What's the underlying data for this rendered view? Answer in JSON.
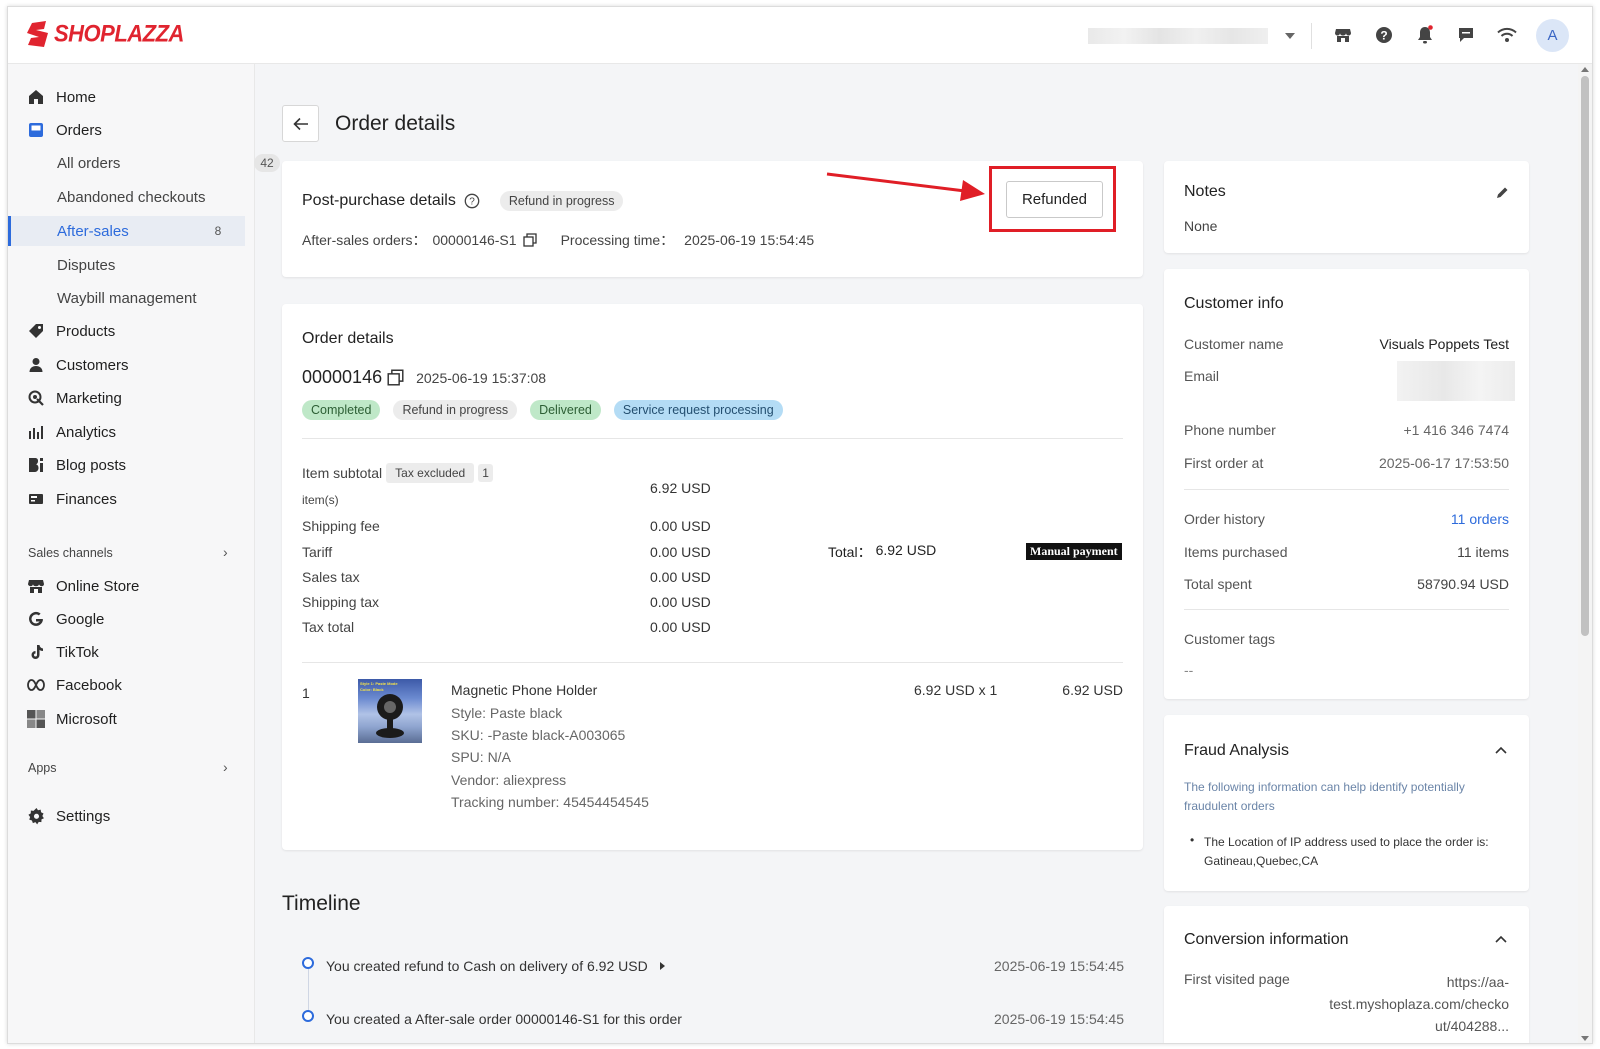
{
  "brand": {
    "logo_text": "SHOPLAZZA",
    "accent": "#e0242f"
  },
  "header": {
    "avatar_initial": "A",
    "icons": [
      "store-icon",
      "help-icon",
      "bell-icon",
      "message-icon",
      "wifi-icon"
    ]
  },
  "sidebar": {
    "items": [
      {
        "label": "Home",
        "icon": "home-icon"
      },
      {
        "label": "Orders",
        "icon": "orders-icon"
      },
      {
        "label": "Products",
        "icon": "tag-icon"
      },
      {
        "label": "Customers",
        "icon": "person-icon"
      },
      {
        "label": "Marketing",
        "icon": "marketing-icon"
      },
      {
        "label": "Analytics",
        "icon": "analytics-icon"
      },
      {
        "label": "Blog posts",
        "icon": "blog-icon"
      },
      {
        "label": "Finances",
        "icon": "finances-icon"
      }
    ],
    "orders_sub": [
      {
        "label": "All orders",
        "count": "42"
      },
      {
        "label": "Abandoned checkouts",
        "count": ""
      },
      {
        "label": "After-sales",
        "count": "8"
      },
      {
        "label": "Disputes",
        "count": ""
      },
      {
        "label": "Waybill management",
        "count": ""
      }
    ],
    "sales_channels_label": "Sales channels",
    "channels": [
      {
        "label": "Online Store",
        "icon": "store-icon"
      },
      {
        "label": "Google",
        "icon": "google-icon"
      },
      {
        "label": "TikTok",
        "icon": "tiktok-icon"
      },
      {
        "label": "Facebook",
        "icon": "meta-icon"
      },
      {
        "label": "Microsoft",
        "icon": "microsoft-icon"
      }
    ],
    "apps_label": "Apps",
    "settings_label": "Settings"
  },
  "page": {
    "title": "Order details"
  },
  "post_purchase": {
    "title": "Post-purchase details",
    "status_tag": "Refund in progress",
    "after_sales_label": "After-sales orders：",
    "after_sales_value": "00000146-S1",
    "processing_label": "Processing time：",
    "processing_value": "2025-06-19 15:54:45",
    "refunded_button": "Refunded"
  },
  "order": {
    "title": "Order details",
    "number": "00000146",
    "date": "2025-06-19 15:37:08",
    "tags": [
      {
        "label": "Completed",
        "style": "green"
      },
      {
        "label": "Refund in progress",
        "style": "gray"
      },
      {
        "label": "Delivered",
        "style": "green"
      },
      {
        "label": "Service request processing",
        "style": "blue"
      }
    ],
    "summary": {
      "item_subtotal_label": "Item subtotal",
      "tax_excluded_tag": "Tax excluded",
      "item_count": "1",
      "items_unit": "item(s)",
      "item_subtotal_value": "6.92 USD",
      "rows": [
        {
          "label": "Shipping fee",
          "value": "0.00 USD"
        },
        {
          "label": "Tariff",
          "value": "0.00 USD"
        },
        {
          "label": "Sales tax",
          "value": "0.00 USD"
        },
        {
          "label": "Shipping tax",
          "value": "0.00 USD"
        },
        {
          "label": "Tax total",
          "value": "0.00 USD"
        }
      ],
      "total_label": "Total：",
      "total_value": "6.92 USD",
      "payment_badge": "Manual payment"
    },
    "line_item": {
      "index": "1",
      "name": "Magnetic Phone Holder",
      "style": "Style: Paste black",
      "sku": "SKU: -Paste black-A003065",
      "spu": "SPU: N/A",
      "vendor": "Vendor: aliexpress",
      "tracking": "Tracking number: 45454454545",
      "unit_price": "6.92 USD x 1",
      "line_total": "6.92 USD",
      "thumb_text_1": "Style 1: Paste Mode",
      "thumb_text_2": "Color: Black"
    }
  },
  "timeline": {
    "title": "Timeline",
    "events": [
      {
        "text": "You created refund to Cash on delivery of 6.92 USD",
        "time": "2025-06-19 15:54:45"
      },
      {
        "text": "You created a After-sale order 00000146-S1 for this order",
        "time": "2025-06-19 15:54:45"
      }
    ]
  },
  "notes": {
    "title": "Notes",
    "value": "None"
  },
  "customer": {
    "title": "Customer info",
    "name_label": "Customer name",
    "name_value": "Visuals Poppets Test",
    "email_label": "Email",
    "phone_label": "Phone number",
    "phone_value": "+1 416 346 7474",
    "first_order_label": "First order at",
    "first_order_value": "2025-06-17 17:53:50",
    "history_label": "Order history",
    "history_value": "11 orders",
    "items_label": "Items purchased",
    "items_value": "11 items",
    "spent_label": "Total spent",
    "spent_value": "58790.94 USD",
    "tags_label": "Customer tags",
    "tags_value": "--"
  },
  "fraud": {
    "title": "Fraud Analysis",
    "intro": "The following information can help identify potentially fraudulent orders",
    "bullet_line1": "The Location of IP address used to place the order is:",
    "bullet_line2": "Gatineau,Quebec,CA"
  },
  "conversion": {
    "title": "Conversion information",
    "first_visited_label": "First visited page",
    "first_visited_line1": "https://aa-",
    "first_visited_line2": "test.myshoplaza.com/checko",
    "first_visited_line3": "ut/404288..."
  }
}
